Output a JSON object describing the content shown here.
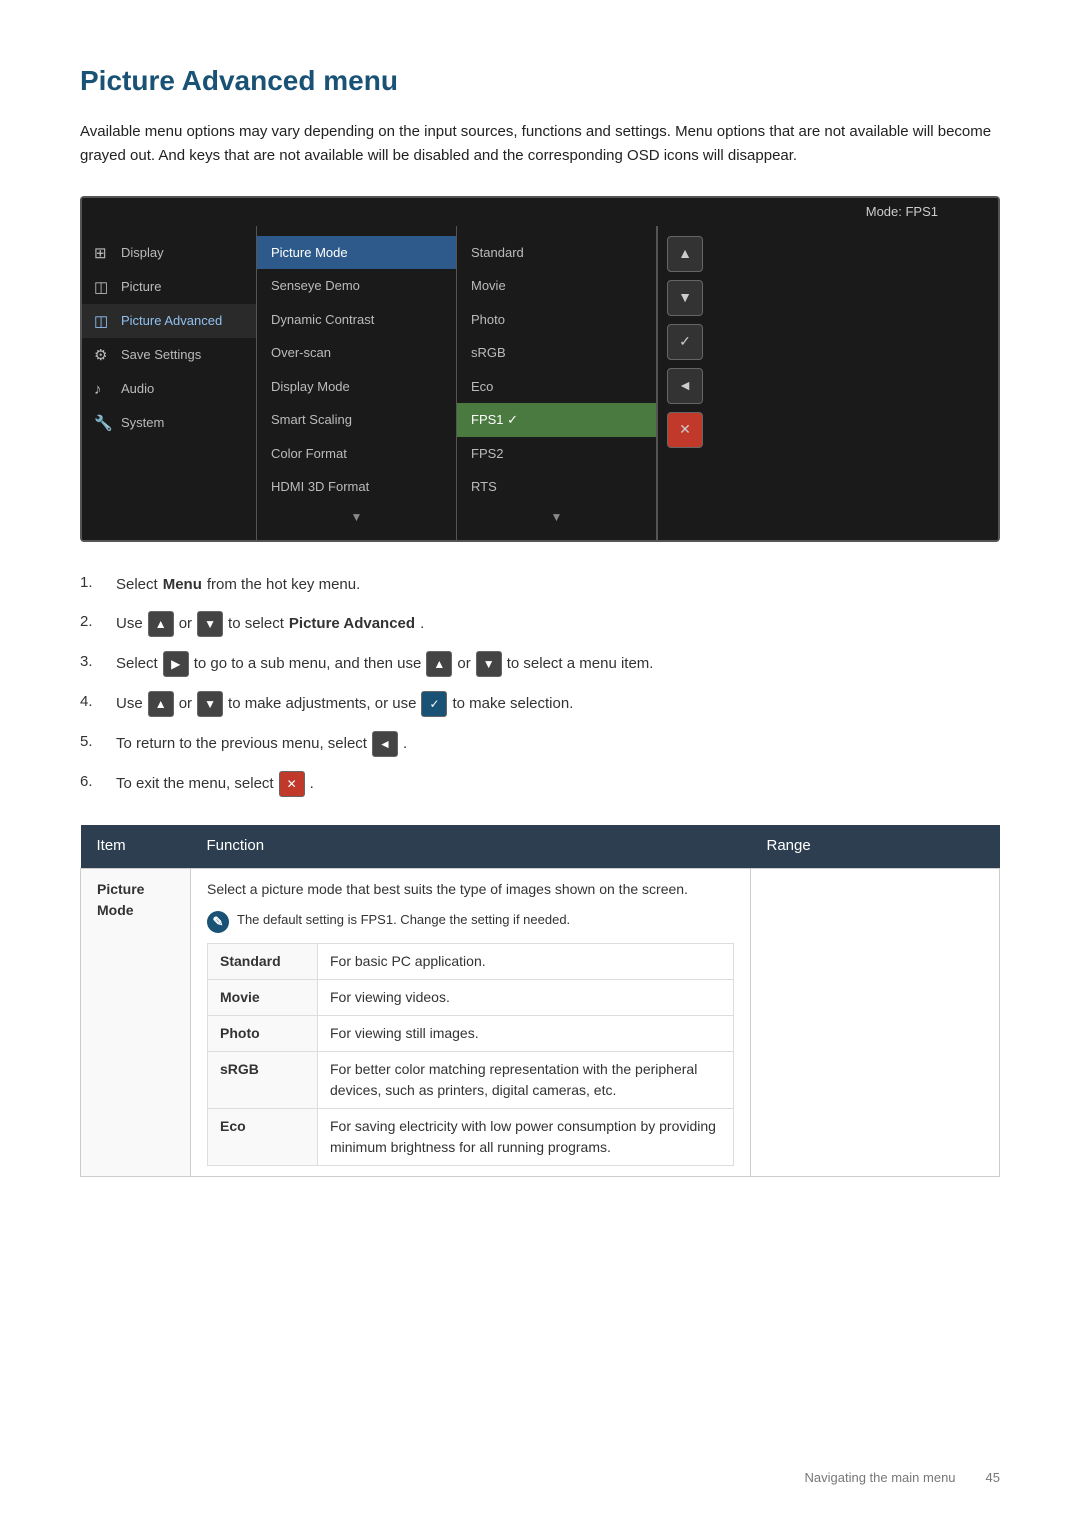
{
  "page": {
    "title": "Picture Advanced menu",
    "intro": "Available menu options may vary depending on the input sources, functions and settings. Menu options that are not available will become grayed out. And keys that are not available will be disabled and the corresponding OSD icons will disappear."
  },
  "osd": {
    "mode_label": "Mode: FPS1",
    "menu_items": [
      {
        "id": "display",
        "label": "Display",
        "icon": "⊞",
        "active": false
      },
      {
        "id": "picture",
        "label": "Picture",
        "icon": "🖼",
        "active": false
      },
      {
        "id": "picture-advanced",
        "label": "Picture Advanced",
        "icon": "🖼",
        "active": true,
        "selected": true
      },
      {
        "id": "save-settings",
        "label": "Save Settings",
        "icon": "⚙",
        "active": false
      },
      {
        "id": "audio",
        "label": "Audio",
        "icon": "♪",
        "active": false
      },
      {
        "id": "system",
        "label": "System",
        "icon": "🔧",
        "active": false
      }
    ],
    "mid_items": [
      {
        "label": "Picture Mode",
        "highlighted": true
      },
      {
        "label": "Senseye Demo",
        "highlighted": false
      },
      {
        "label": "Dynamic Contrast",
        "highlighted": false
      },
      {
        "label": "Over-scan",
        "highlighted": false
      },
      {
        "label": "Display Mode",
        "highlighted": false
      },
      {
        "label": "Smart Scaling",
        "highlighted": false
      },
      {
        "label": "Color Format",
        "highlighted": false
      },
      {
        "label": "HDMI 3D Format",
        "highlighted": false
      }
    ],
    "right_items": [
      {
        "label": "Standard",
        "highlighted": false
      },
      {
        "label": "Movie",
        "highlighted": false
      },
      {
        "label": "Photo",
        "highlighted": false
      },
      {
        "label": "sRGB",
        "highlighted": false
      },
      {
        "label": "Eco",
        "highlighted": false
      },
      {
        "label": "FPS1 ✓",
        "highlighted": true
      },
      {
        "label": "FPS2",
        "highlighted": false
      },
      {
        "label": "RTS",
        "highlighted": false
      }
    ],
    "buttons": [
      "▲",
      "▼",
      "✓",
      "◄",
      "✕"
    ]
  },
  "steps": [
    {
      "num": "1.",
      "text_before": "Select",
      "bold": "Menu",
      "text_after": "from the hot key menu.",
      "has_icons": false
    },
    {
      "num": "2.",
      "text_before": "Use",
      "icons": [
        "up",
        "down"
      ],
      "text_after": "to select",
      "bold": "Picture Advanced",
      "has_icons": true
    },
    {
      "num": "3.",
      "text_before": "Select",
      "icons": [
        "right"
      ],
      "text_mid": "to go to a sub menu, and then use",
      "icons2": [
        "up",
        "down"
      ],
      "text_after": "to select a menu item.",
      "has_icons": true
    },
    {
      "num": "4.",
      "text_before": "Use",
      "icons": [
        "up",
        "down"
      ],
      "text_mid": "to make adjustments, or use",
      "icons2": [
        "check"
      ],
      "text_after": "to make selection.",
      "has_icons": true
    },
    {
      "num": "5.",
      "text": "To return to the previous menu, select",
      "icon": "back",
      "has_icons": true
    },
    {
      "num": "6.",
      "text": "To exit the menu, select",
      "icon": "ex",
      "has_icons": true
    }
  ],
  "table": {
    "headers": [
      "Item",
      "Function",
      "Range"
    ],
    "rows": [
      {
        "item": "Picture Mode",
        "function_intro": "Select a picture mode that best suits the type of images shown on the screen.",
        "note": "The default setting is FPS1. Change the setting if needed.",
        "sub_rows": [
          {
            "label": "Standard",
            "desc": "For basic PC application."
          },
          {
            "label": "Movie",
            "desc": "For viewing videos."
          },
          {
            "label": "Photo",
            "desc": "For viewing still images."
          },
          {
            "label": "sRGB",
            "desc": "For better color matching representation with the peripheral devices, such as printers, digital cameras, etc."
          },
          {
            "label": "Eco",
            "desc": "For saving electricity with low power consumption by providing minimum brightness for all running programs."
          }
        ]
      }
    ]
  },
  "footer": {
    "nav_text": "Navigating the main menu",
    "page_num": "45"
  }
}
